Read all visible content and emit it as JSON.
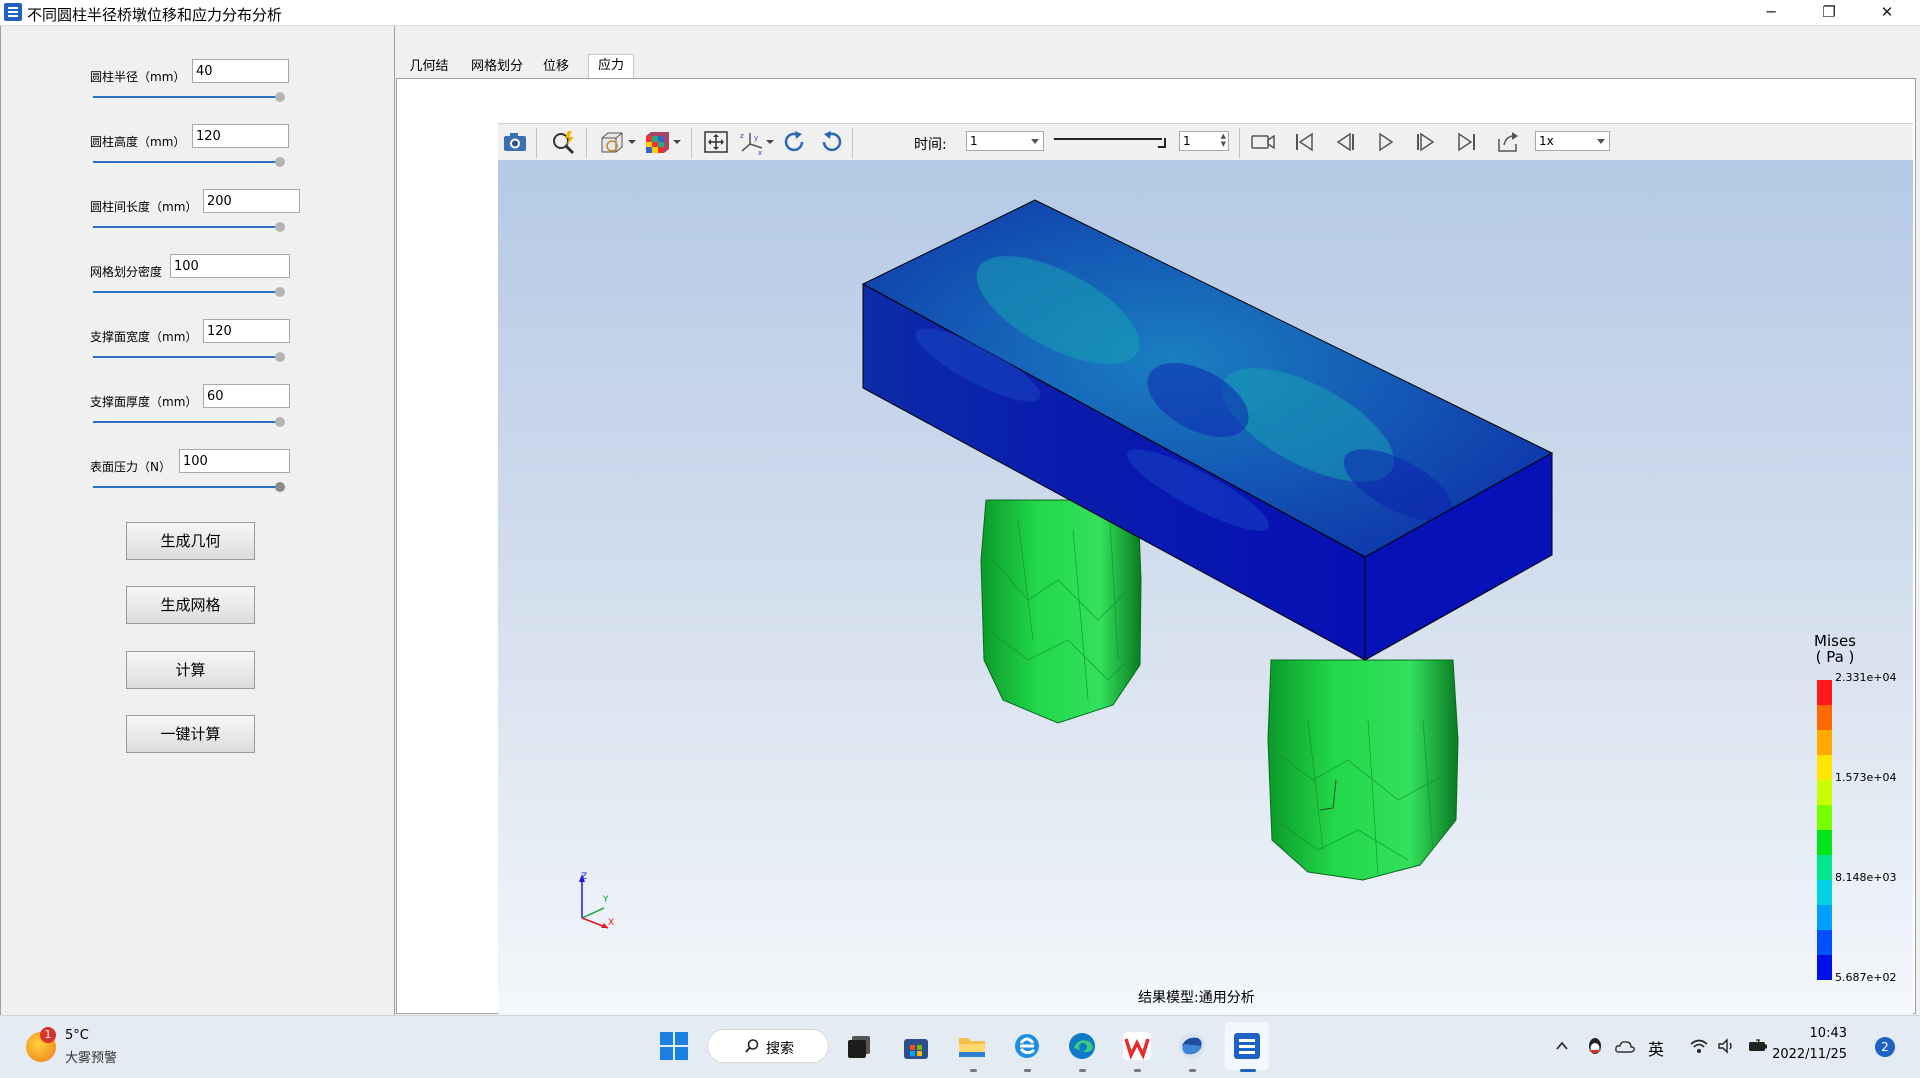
{
  "window": {
    "title": "不同圆柱半径桥墩位移和应力分布分析",
    "minimize_glyph": "─",
    "maximize_glyph": "❐",
    "close_glyph": "✕",
    "icon": "app-icon"
  },
  "params": [
    {
      "label": "圆柱半径（mm）",
      "value": "40",
      "slider_level": 1.0
    },
    {
      "label": "圆柱高度（mm）",
      "value": "120",
      "slider_level": 1.0
    },
    {
      "label": "圆柱间长度（mm）",
      "value": "200",
      "slider_level": 1.0
    },
    {
      "label": "网格划分密度",
      "value": "100",
      "slider_level": 1.0
    },
    {
      "label": "支撑面宽度（mm）",
      "value": "120",
      "slider_level": 1.0
    },
    {
      "label": "支撑面厚度（mm）",
      "value": "60",
      "slider_level": 1.0
    },
    {
      "label": "表面压力（N）",
      "value": "100",
      "slider_level": 1.0
    }
  ],
  "buttons": {
    "generate_geometry": "生成几何",
    "generate_mesh": "生成网格",
    "compute": "计算",
    "one_click_compute": "一键计算"
  },
  "tabs": [
    {
      "label": "几何结构",
      "active": false
    },
    {
      "label": "网格划分",
      "active": false
    },
    {
      "label": "位移",
      "active": false
    },
    {
      "label": "应力",
      "active": true
    }
  ],
  "toolbar": {
    "time_label": "时间:",
    "time_value": "1",
    "frame_value": "1",
    "speed_value": "1x",
    "icons": [
      "camera-icon",
      "zoom-icon",
      "display-mode-icon",
      "color-cube-icon",
      "fit-view-icon",
      "axes-icon",
      "rotate-cw-icon",
      "rotate-ccw-icon",
      "record-icon",
      "first-frame-icon",
      "prev-frame-icon",
      "play-icon",
      "next-frame-icon",
      "last-frame-icon",
      "export-icon"
    ]
  },
  "viewport": {
    "footer_text": "结果模型:通用分析",
    "axes": {
      "z": "Z",
      "y": "Y",
      "x": "X"
    }
  },
  "legend": {
    "title": "Mises",
    "unit": "( Pa )",
    "ticks": [
      "2.331e+04",
      "1.573e+04",
      "8.148e+03",
      "5.687e+02"
    ],
    "colors": [
      "#ff1a1a",
      "#ff6a00",
      "#ffaa00",
      "#ffe600",
      "#c8ff00",
      "#78ff00",
      "#00e61a",
      "#00e68c",
      "#00d2e6",
      "#00a0ff",
      "#0050ff",
      "#0010e6"
    ]
  },
  "taskbar": {
    "weather_temp": "5°C",
    "weather_desc": "大雾预警",
    "weather_badge": "1",
    "search_label": "搜索",
    "ime": "英",
    "time": "10:43",
    "date": "2022/11/25",
    "notification_count": "2",
    "apps": [
      "start-icon",
      "search-icon",
      "taskview-icon",
      "store-icon",
      "file-explorer-icon",
      "ie-icon",
      "edge-icon",
      "wps-icon",
      "app-swirl-icon",
      "app-active-icon"
    ]
  }
}
